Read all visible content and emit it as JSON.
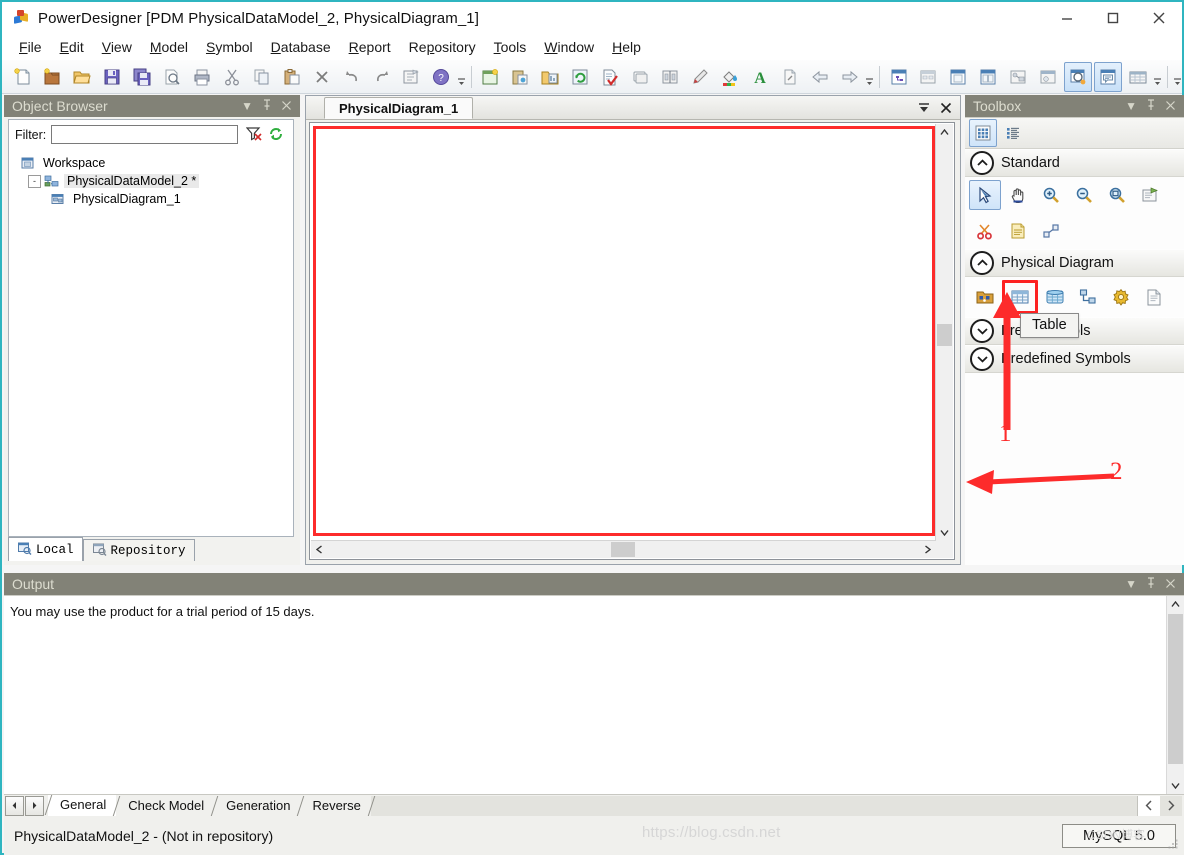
{
  "window": {
    "title": "PowerDesigner [PDM PhysicalDataModel_2, PhysicalDiagram_1]",
    "controls": {
      "minimize": "minimize-icon",
      "maximize": "maximize-icon",
      "close": "close-icon"
    }
  },
  "menu": {
    "items": [
      {
        "label": "File",
        "accel": "F"
      },
      {
        "label": "Edit",
        "accel": "E"
      },
      {
        "label": "View",
        "accel": "V"
      },
      {
        "label": "Model",
        "accel": "M"
      },
      {
        "label": "Symbol",
        "accel": "S"
      },
      {
        "label": "Database",
        "accel": "D"
      },
      {
        "label": "Report",
        "accel": "R"
      },
      {
        "label": "Repository",
        "accel": "R"
      },
      {
        "label": "Tools",
        "accel": "T"
      },
      {
        "label": "Window",
        "accel": "W"
      },
      {
        "label": "Help",
        "accel": "H"
      }
    ]
  },
  "toolbar": {
    "group1": [
      "new-icon",
      "new-model-icon",
      "open-icon",
      "save-icon",
      "save-all-icon",
      "print-preview-icon",
      "print-icon",
      "cut-icon",
      "copy-icon",
      "paste-icon",
      "delete-icon",
      "undo-icon",
      "redo-icon",
      "properties-icon",
      "help-icon"
    ],
    "group2": [
      "new-diagram-icon",
      "paste-format-icon",
      "find-objects-icon",
      "refresh-icon",
      "check-model-icon",
      "shape-icon",
      "align-icon",
      "pencil-icon",
      "fill-color-icon",
      "font-color-icon",
      "export-icon",
      "previous-icon",
      "next-icon"
    ],
    "group3": [
      "browser-icon",
      "result-list-icon",
      "page-icon",
      "tile-icon",
      "dependency-icon",
      "impact-icon",
      "zoom-tool-icon",
      "comment-icon",
      "grid-icon"
    ]
  },
  "object_browser": {
    "title": "Object Browser",
    "title_buttons": [
      "dropdown-icon",
      "pin-icon",
      "close-icon"
    ],
    "filter": {
      "label": "Filter:",
      "value": "",
      "placeholder": ""
    },
    "filter_buttons": [
      "clear-filter-icon",
      "refresh-filter-icon"
    ],
    "tree": [
      {
        "label": "Workspace",
        "icon": "workspace-icon",
        "level": 0,
        "selected": false,
        "expander": null
      },
      {
        "label": "PhysicalDataModel_2 *",
        "icon": "model-icon",
        "level": 1,
        "selected": true,
        "expander": "-"
      },
      {
        "label": "PhysicalDiagram_1",
        "icon": "diagram-icon",
        "level": 2,
        "selected": false,
        "expander": null
      }
    ],
    "tabs": [
      {
        "label": "Local",
        "icon": "local-icon",
        "active": true
      },
      {
        "label": "Repository",
        "icon": "repository-icon",
        "active": false
      }
    ]
  },
  "diagram": {
    "tab_label": "PhysicalDiagram_1",
    "window_buttons": [
      "restore-icon",
      "close-icon"
    ],
    "canvas_highlight_color": "#fd2b2b",
    "scroll": {
      "vertical_thumb_pos": "48%",
      "horizontal_thumb_pos": "48%"
    }
  },
  "toolbox": {
    "title": "Toolbox",
    "title_buttons": [
      "dropdown-icon",
      "pin-icon",
      "close-icon"
    ],
    "view_modes": [
      {
        "name": "grid-view-icon",
        "selected": true
      },
      {
        "name": "list-view-icon",
        "selected": false
      }
    ],
    "groups": [
      {
        "name": "Standard",
        "expanded": true,
        "rows": [
          [
            {
              "name": "pointer-icon",
              "selected": true
            },
            {
              "name": "grabber-hand-icon",
              "selected": false
            },
            {
              "name": "zoom-in-icon",
              "selected": false
            },
            {
              "name": "zoom-out-icon",
              "selected": false
            },
            {
              "name": "zoom-area-icon",
              "selected": false
            },
            {
              "name": "open-package-diagram-icon",
              "selected": false
            }
          ],
          [
            {
              "name": "delete-scissors-icon",
              "selected": false
            },
            {
              "name": "note-icon",
              "selected": false
            },
            {
              "name": "link-icon",
              "selected": false
            }
          ]
        ]
      },
      {
        "name": "Physical Diagram",
        "expanded": true,
        "rows": [
          [
            {
              "name": "package-icon",
              "selected": false
            },
            {
              "name": "table-icon",
              "selected": false,
              "highlighted": true
            },
            {
              "name": "view-icon",
              "selected": false
            },
            {
              "name": "reference-icon",
              "selected": false
            },
            {
              "name": "procedure-icon",
              "selected": false
            },
            {
              "name": "file-icon",
              "selected": false
            }
          ]
        ]
      },
      {
        "name": "Free Symbols",
        "expanded": false,
        "rows": []
      },
      {
        "name": "Predefined Symbols",
        "expanded": false,
        "rows": []
      }
    ],
    "tooltip": "Table"
  },
  "annotations": [
    {
      "label": "1",
      "type": "arrow-up",
      "target": "table-icon"
    },
    {
      "label": "2",
      "type": "arrow-left",
      "target": "toolbox-panel"
    }
  ],
  "output": {
    "title": "Output",
    "title_buttons": [
      "dropdown-icon",
      "pin-icon",
      "close-icon"
    ],
    "lines": [
      "You may use the product for a trial period of 15 days."
    ]
  },
  "bottom_tabs": {
    "nav": [
      "prev-tab-icon",
      "next-tab-icon"
    ],
    "items": [
      {
        "label": "General",
        "active": true
      },
      {
        "label": "Check Model",
        "active": false
      },
      {
        "label": "Generation",
        "active": false
      },
      {
        "label": "Reverse",
        "active": false
      }
    ],
    "scroll_arrows": [
      "scroll-left-icon",
      "scroll-right-icon"
    ]
  },
  "status_bar": {
    "text": "PhysicalDataModel_2 - (Not in repository)",
    "database": "MySQL 5.0",
    "watermark": "https://blog.csdn.net",
    "watermark2": "CSDN博客"
  }
}
